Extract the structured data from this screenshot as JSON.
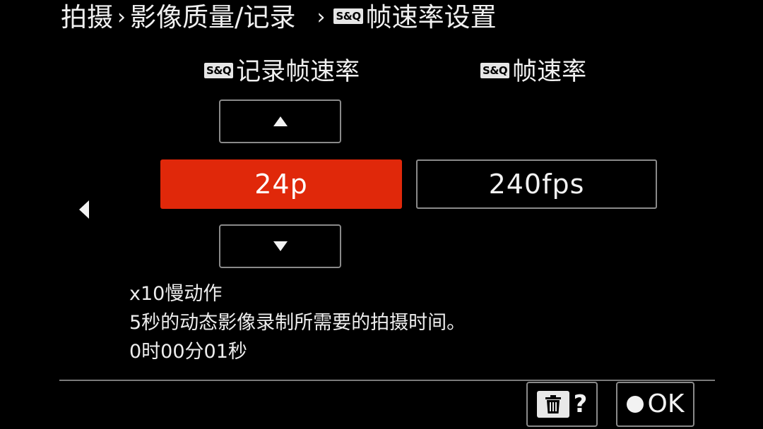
{
  "breadcrumb": {
    "part1": "拍摄",
    "part2": "影像质量/记录",
    "sep": "›",
    "badge": "S&Q",
    "part3": "帧速率设置"
  },
  "columns": {
    "left_badge": "S&Q",
    "left_label": "记录帧速率",
    "right_badge": "S&Q",
    "right_label": "帧速率"
  },
  "values": {
    "record_frame_rate": "24p",
    "frame_rate": "240fps"
  },
  "icons": {
    "up": "triangle-up-icon",
    "down": "triangle-down-icon",
    "left": "triangle-left-icon",
    "trash": "trash-icon",
    "ok": "circle-button-icon"
  },
  "info": {
    "line1": "x10慢动作",
    "line2": "5秒的动态影像录制所需要的拍摄时间。",
    "line3": "0时00分01秒"
  },
  "footer": {
    "help_label": "?",
    "ok_label": "OK"
  },
  "colors": {
    "selected": "#e0280a",
    "background": "#000000",
    "border": "#8a8a8a"
  }
}
